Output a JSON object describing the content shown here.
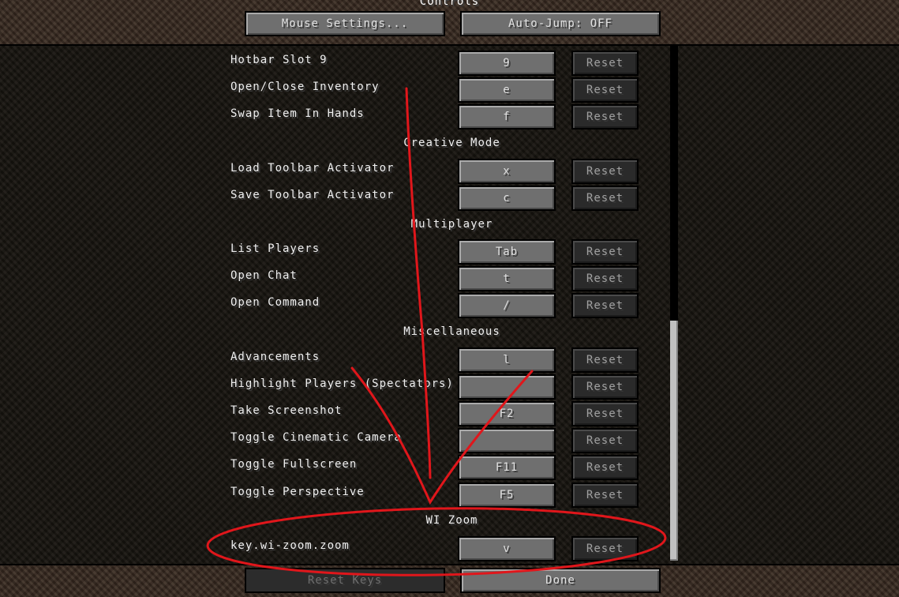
{
  "screen": {
    "title": "Controls",
    "mouse_settings_label": "Mouse Settings...",
    "auto_jump_label": "Auto-Jump: OFF",
    "reset_keys_label": "Reset Keys",
    "done_label": "Done"
  },
  "reset_label": "Reset",
  "rows": [
    {
      "label": "Hotbar Slot 9",
      "key": "9"
    },
    {
      "label": "Open/Close Inventory",
      "key": "e"
    },
    {
      "label": "Swap Item In Hands",
      "key": "f"
    },
    {
      "label": "Load Toolbar Activator",
      "key": "x"
    },
    {
      "label": "Save Toolbar Activator",
      "key": "c"
    },
    {
      "label": "List Players",
      "key": "Tab"
    },
    {
      "label": "Open Chat",
      "key": "t"
    },
    {
      "label": "Open Command",
      "key": "/"
    },
    {
      "label": "Advancements",
      "key": "l"
    },
    {
      "label": "Highlight Players (Spectators)",
      "key": ""
    },
    {
      "label": "Take Screenshot",
      "key": "F2"
    },
    {
      "label": "Toggle Cinematic Camera",
      "key": ""
    },
    {
      "label": "Toggle Fullscreen",
      "key": "F11"
    },
    {
      "label": "Toggle Perspective",
      "key": "F5"
    },
    {
      "label": "key.wi-zoom.zoom",
      "key": "v"
    }
  ],
  "categories": [
    "Creative Mode",
    "Multiplayer",
    "Miscellaneous",
    "WI Zoom"
  ],
  "scroll_position": 0.95,
  "colors": {
    "annotation": "#e0161b",
    "button": "#6f6f6f",
    "reset_button": "#2a2a2a"
  }
}
